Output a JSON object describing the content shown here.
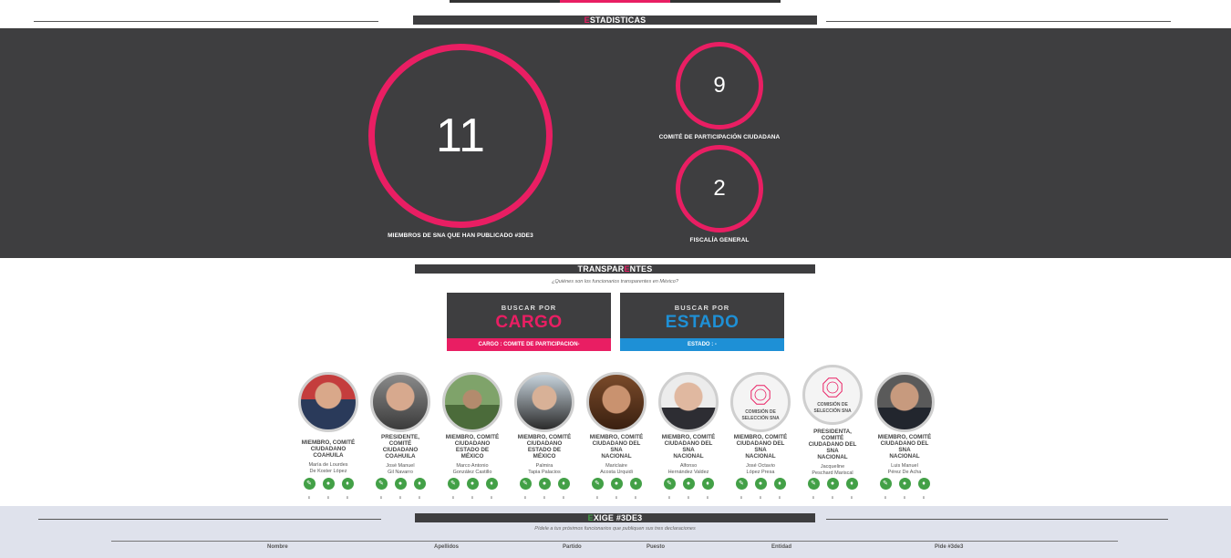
{
  "nav": {
    "accent": "#e91e63"
  },
  "estadisticas": {
    "title_first": "E",
    "title_rest": "STADISTICAS",
    "total": {
      "value": "11",
      "label": "MIEMBROS DE SNA QUE HAN PUBLICADO #3DE3"
    },
    "cpc": {
      "value": "9",
      "label": "COMITÉ DE PARTICIPACIÓN CIUDADANA"
    },
    "fiscalia": {
      "value": "2",
      "label": "FISCALÍA GENERAL"
    }
  },
  "transparentes": {
    "title_a": "TRANSPAR",
    "title_b": "E",
    "title_c": "NTES",
    "subtitle": "¿Quiénes son los funcionarios transparentes en México?",
    "cargo": {
      "small": "BUSCAR POR",
      "big": "CARGO",
      "bar": "CARGO : COMITE DE PARTICIPACION-",
      "color": "#e91e63"
    },
    "estado": {
      "small": "BUSCAR POR",
      "big": "ESTADO",
      "bar": "ESTADO : -",
      "color": "#1e90d6"
    }
  },
  "members": [
    {
      "role": [
        "MIEMBRO, COMITÉ",
        "CIUDADANO",
        "COAHUILA"
      ],
      "name": [
        "María de Lourdes",
        "De Koster López"
      ],
      "avatar": "photo-woman"
    },
    {
      "role": [
        "PRESIDENTE,",
        "COMITÉ",
        "CIUDADANO",
        "COAHUILA"
      ],
      "name": [
        "José Manuel",
        "Gil Navarro"
      ],
      "avatar": "photo-man"
    },
    {
      "role": [
        "MIEMBRO, COMITÉ",
        "CIUDADANO",
        "ESTADO DE",
        "MÉXICO"
      ],
      "name": [
        "Marco Antonio",
        "González Castillo"
      ],
      "avatar": "photo-outdoor"
    },
    {
      "role": [
        "MIEMBRO, COMITÉ",
        "CIUDADANO",
        "ESTADO DE",
        "MÉXICO"
      ],
      "name": [
        "Palmira",
        "Tapia Palacios"
      ],
      "avatar": "photo-woman2"
    },
    {
      "role": [
        "MIEMBRO, COMITÉ",
        "CIUDADANO DEL",
        "SNA",
        "NACIONAL"
      ],
      "name": [
        "Mariclaire",
        "Acosta Urquidi"
      ],
      "avatar": "photo-woman3"
    },
    {
      "role": [
        "MIEMBRO, COMITÉ",
        "CIUDADANO DEL",
        "SNA",
        "NACIONAL"
      ],
      "name": [
        "Alfonso",
        "Hernández Valdez"
      ],
      "avatar": "photo-man2"
    },
    {
      "role": [
        "MIEMBRO, COMITÉ",
        "CIUDADANO DEL",
        "SNA",
        "NACIONAL"
      ],
      "name": [
        "José Octavio",
        "López Presa"
      ],
      "avatar": "logo-sna",
      "logo_text": [
        "COMISIÓN DE",
        "SELECCIÓN SNA"
      ]
    },
    {
      "role": [
        "PRESIDENTA,",
        "COMITÉ",
        "CIUDADANO DEL",
        "SNA",
        "NACIONAL"
      ],
      "name": [
        "Jacqueline",
        "Peschard Mariscal"
      ],
      "avatar": "logo-sna",
      "logo_text": [
        "COMISIÓN DE",
        "SELECCIÓN SNA"
      ]
    },
    {
      "role": [
        "MIEMBRO, COMITÉ",
        "CIUDADANO DEL",
        "SNA",
        "NACIONAL"
      ],
      "name": [
        "Luis Manuel",
        "Pérez De Acha"
      ],
      "avatar": "photo-man3"
    }
  ],
  "icons": [
    {
      "name": "pencil-icon",
      "glyph": "✎"
    },
    {
      "name": "chat-icon",
      "glyph": "●"
    },
    {
      "name": "drop-icon",
      "glyph": "♦"
    }
  ],
  "icon_colors": {
    "green": "#43a047"
  },
  "exige": {
    "title_first": "E",
    "title_rest": "XIGE #3DE3",
    "subtitle": "Pídele a tus próximos funcionarios que publiquen sus tres declaraciones",
    "columns": [
      "Nombre",
      "Apellidos",
      "Partido",
      "Puesto",
      "Entidad",
      "Pide #3de3"
    ]
  }
}
